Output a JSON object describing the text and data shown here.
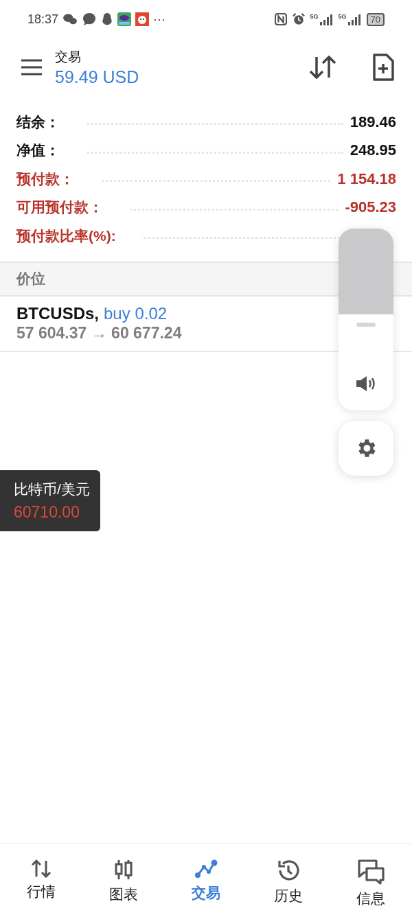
{
  "status_bar": {
    "time": "18:37",
    "more": "···",
    "network_labels": [
      "5G",
      "5G"
    ],
    "battery": "70"
  },
  "header": {
    "title": "交易",
    "balance": "59.49 USD"
  },
  "account": [
    {
      "label": "结余：",
      "value": "189.46",
      "kind": "normal"
    },
    {
      "label": "净值：",
      "value": "248.95",
      "kind": "normal"
    },
    {
      "label": "预付款：",
      "value": "1 154.18",
      "kind": "warning"
    },
    {
      "label": "可用预付款：",
      "value": "-905.23",
      "kind": "warning"
    },
    {
      "label": "预付款比率(%):",
      "kind": "warning"
    }
  ],
  "section": {
    "title": "价位"
  },
  "positions": [
    {
      "symbol": "BTCUSDs,",
      "side": "buy 0.02",
      "prices": "57 604.37 → 60 677.24"
    }
  ],
  "price_tooltip": {
    "title": "比特币/美元",
    "price": "60710.00"
  },
  "tabs": [
    {
      "label": "行情",
      "kind": "quotes",
      "selected": false
    },
    {
      "label": "图表",
      "kind": "chart",
      "selected": false
    },
    {
      "label": "交易",
      "kind": "trade",
      "selected": true
    },
    {
      "label": "历史",
      "kind": "history",
      "selected": false
    },
    {
      "label": "信息",
      "kind": "messages",
      "selected": false
    }
  ]
}
